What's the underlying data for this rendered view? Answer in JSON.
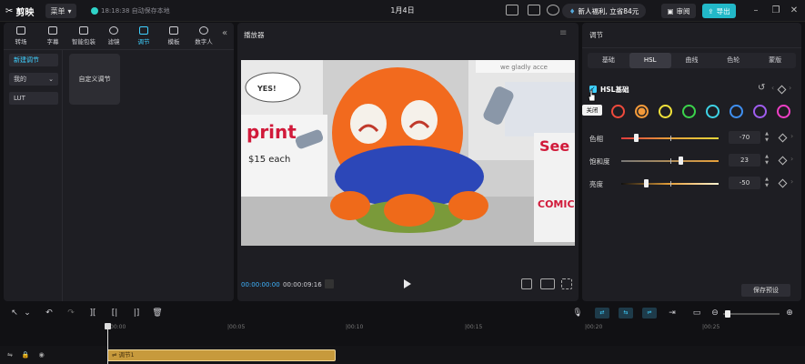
{
  "titlebar": {
    "app_name": "剪映",
    "menu_label": "菜单",
    "autosave": "18:18:38 自动保存本地",
    "project_title": "1月4日",
    "promo": "新人福利, 立省84元",
    "review_label": "审阅",
    "export_label": "导出"
  },
  "tool_tabs": [
    {
      "label": "转场",
      "icon": "transition-icon"
    },
    {
      "label": "字幕",
      "icon": "subtitle-icon"
    },
    {
      "label": "智能包装",
      "icon": "smart-pack-icon"
    },
    {
      "label": "滤镜",
      "icon": "filter-icon"
    },
    {
      "label": "调节",
      "icon": "adjust-icon",
      "active": true
    },
    {
      "label": "模板",
      "icon": "template-icon"
    },
    {
      "label": "数字人",
      "icon": "avatar-icon"
    }
  ],
  "left_sidebar": {
    "items": [
      "新建调节",
      "我的",
      "LUT"
    ],
    "card_label": "自定义调节"
  },
  "player": {
    "title": "播放器",
    "current_time": "00:00:00:00",
    "duration": "00:00:09:16",
    "video_texts": {
      "we_gladly": "we gladly acce",
      "yes": "YES!",
      "print": "print",
      "price": "$15 each",
      "see": "See",
      "comic": "COMIC"
    }
  },
  "adjust": {
    "title": "调节",
    "tabs": [
      "基础",
      "HSL",
      "曲线",
      "色轮",
      "蒙版"
    ],
    "active_tab": "HSL",
    "hsl_label": "HSL基础",
    "tooltip": "关闭",
    "swatches": [
      "#ef4a3c",
      "#f39a3a",
      "#f1e23a",
      "#3bd34b",
      "#3ed3e6",
      "#3f8ff0",
      "#a05df0",
      "#ef3fc6"
    ],
    "selected_swatch_index": 1,
    "sliders": [
      {
        "label": "色相",
        "value": "-70",
        "fraction": 0.15
      },
      {
        "label": "饱和度",
        "value": "23",
        "fraction": 0.61
      },
      {
        "label": "亮度",
        "value": "-50",
        "fraction": 0.25
      }
    ],
    "save_preset_label": "保存预设"
  },
  "timeline": {
    "ruler_labels": [
      "00:00",
      "|00:05",
      "|00:10",
      "|00:15",
      "|00:20",
      "|00:25"
    ],
    "clip_label": "调节1"
  },
  "colors": {
    "accent": "#3fd0ff",
    "export_bg": "#22b8c8",
    "clip_bg": "#c79a3c"
  }
}
